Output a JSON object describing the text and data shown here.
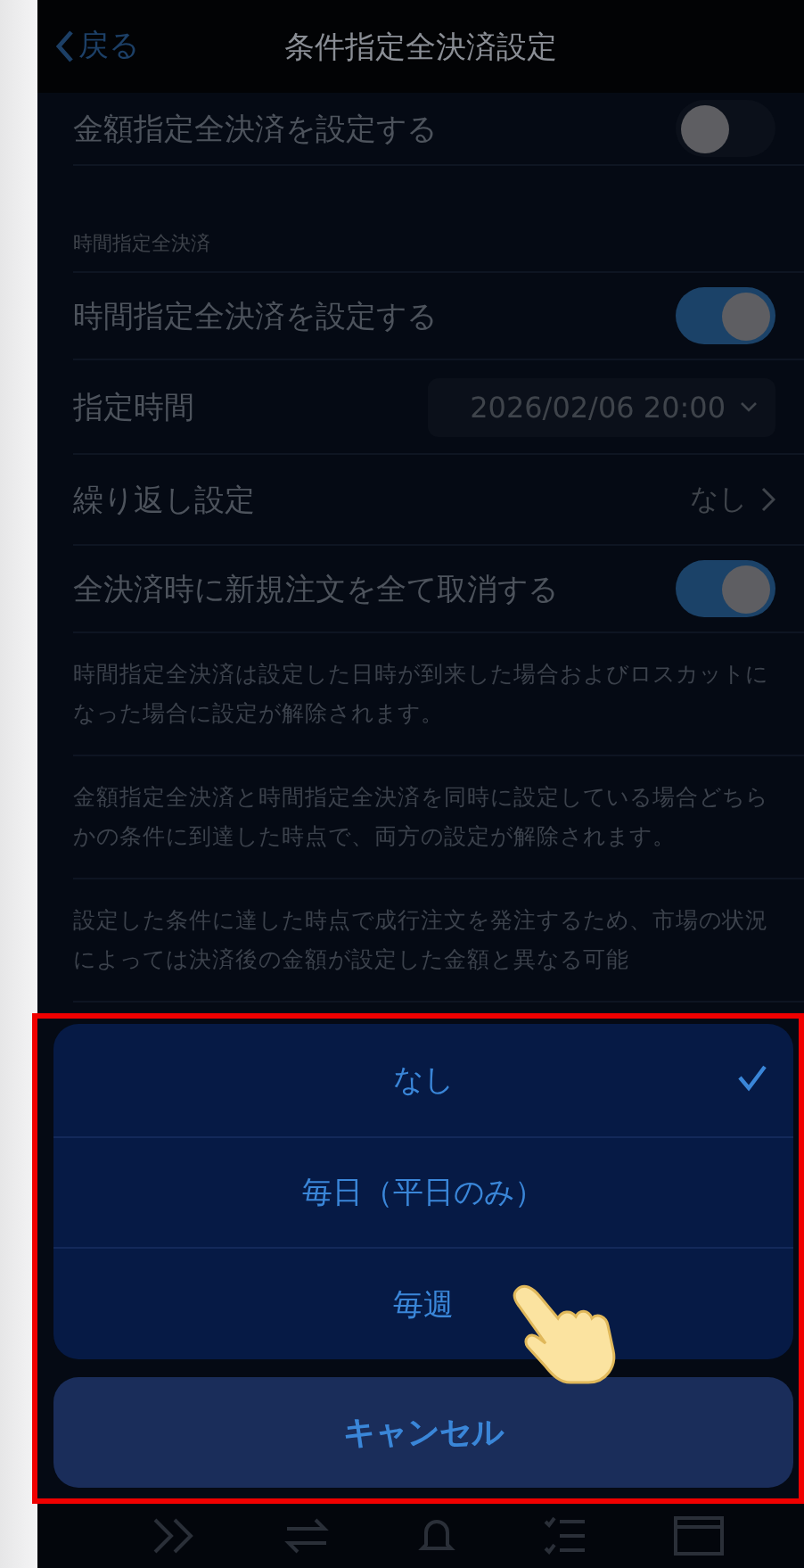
{
  "header": {
    "back": "戻る",
    "title": "条件指定全決済設定"
  },
  "rows": [
    {
      "kind": "toggle",
      "label": "金額指定全決済を設定する",
      "on": false
    },
    {
      "kind": "section",
      "label": "時間指定全決済"
    },
    {
      "kind": "toggle",
      "label": "時間指定全決済を設定する",
      "on": true
    },
    {
      "kind": "select",
      "label": "指定時間",
      "value": "2026/02/06 20:00"
    },
    {
      "kind": "link",
      "label": "繰り返し設定",
      "value": "なし"
    },
    {
      "kind": "toggle",
      "label": "全決済時に新規注文を全て取消する",
      "on": true
    },
    {
      "kind": "note",
      "text": "時間指定全決済は設定した日時が到来した場合およびロスカットになった場合に設定が解除されます。"
    },
    {
      "kind": "note",
      "text": "金額指定全決済と時間指定全決済を同時に設定している場合どちらかの条件に到達した時点で、両方の設定が解除されます。"
    },
    {
      "kind": "note",
      "text": "設定した条件に達した時点で成行注文を発注するため、市場の状況によっては決済後の金額が設定した金額と異なる可能"
    }
  ],
  "sheet": {
    "options": [
      {
        "label": "なし",
        "selected": true
      },
      {
        "label": "毎日（平日のみ）",
        "selected": false
      },
      {
        "label": "毎週",
        "selected": false
      }
    ],
    "cancel": "キャンセル"
  }
}
